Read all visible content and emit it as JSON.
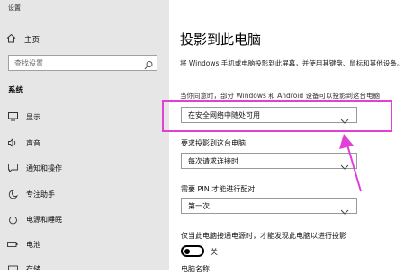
{
  "window": {
    "title": "设置"
  },
  "sidebar": {
    "home_label": "主页",
    "search_placeholder": "查找设置",
    "section": "系统",
    "items": [
      {
        "label": "显示",
        "icon": "monitor-icon"
      },
      {
        "label": "声音",
        "icon": "speaker-icon"
      },
      {
        "label": "通知和操作",
        "icon": "notification-icon"
      },
      {
        "label": "专注助手",
        "icon": "moon-icon"
      },
      {
        "label": "电源和睡眠",
        "icon": "power-icon"
      },
      {
        "label": "电池",
        "icon": "battery-icon"
      },
      {
        "label": "存储",
        "icon": "storage-icon"
      }
    ]
  },
  "main": {
    "title": "投影到此电脑",
    "description": "将 Windows 手机或电脑投影到此屏幕，并使用其键盘、鼠标和其他设备。",
    "description_cut": "当你同意时，部分 Windows 和 Android 设备可以投影到这台电脑",
    "dropdown1_value": "在安全网络中随处可用",
    "label2": "要求投影到这台电脑",
    "dropdown2_value": "每次请求连接时",
    "label3": "需要 PIN 才能进行配对",
    "dropdown3_value": "第一次",
    "label4": "仅当此电脑接通电源时，才能发现此电脑以进行投影",
    "toggle_label": "关",
    "toggle_on": false,
    "cut_bottom": "电脑名称"
  },
  "colors": {
    "highlight": "#e040d8",
    "sidebar_bg": "#e6e6e6"
  }
}
